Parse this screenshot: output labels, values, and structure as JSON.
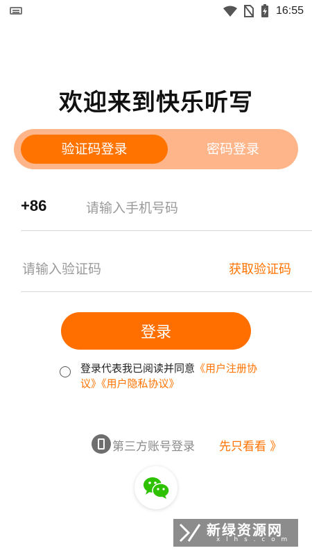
{
  "status_bar": {
    "time": "16:55",
    "icons": [
      "keyboard-icon",
      "wifi-icon",
      "no-sim-icon",
      "battery-charging-icon"
    ]
  },
  "title": "欢迎来到快乐听写",
  "tabs": {
    "active": "验证码登录",
    "inactive": "密码登录"
  },
  "phone": {
    "country_code": "+86",
    "placeholder": "请输入手机号码"
  },
  "code": {
    "placeholder": "请输入验证码",
    "get_code": "获取验证码"
  },
  "login_button": "登录",
  "agreement": {
    "prefix": "登录代表我已阅读并同意",
    "user_agreement": "《用户注册协议》",
    "privacy": "《用户隐私协议》"
  },
  "third_party": {
    "label": "第三方账号登录",
    "browse": "先只看看 》"
  },
  "watermark": {
    "text": "新绿资源网",
    "sub": "x l h s . c o m"
  },
  "colors": {
    "accent": "#ff7300",
    "tab_bg": "#ffb58a",
    "wechat": "#2dc100"
  }
}
